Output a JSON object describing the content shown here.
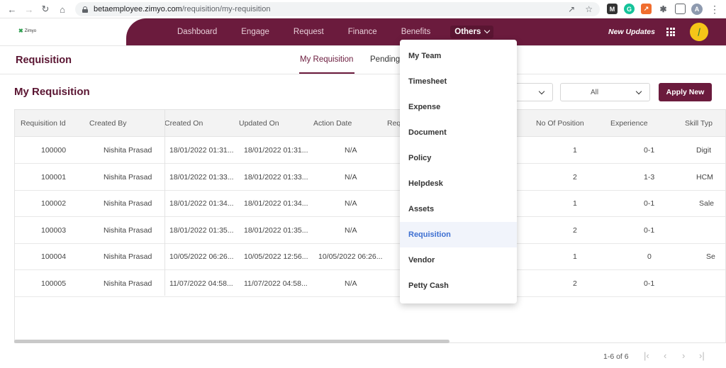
{
  "browser": {
    "url_host": "betaemployee.zimyo.com",
    "url_path": "/requisition/my-requisition",
    "profile_initial": "A"
  },
  "app": {
    "logo_text": "Zimyo",
    "nav": [
      "Dashboard",
      "Engage",
      "Request",
      "Finance",
      "Benefits"
    ],
    "nav_active": "Others",
    "new_updates": "New Updates",
    "brand_color": "#6b1b3d"
  },
  "subheader": {
    "title": "Requisition",
    "tab_active": "My Requisition",
    "tab_pending": "Pending"
  },
  "section": {
    "title": "My Requisition",
    "filter_value": "All",
    "apply_label": "Apply New"
  },
  "table": {
    "headers": [
      "Requisition Id",
      "Created By",
      "Created On",
      "Updated On",
      "Action Date",
      "Req",
      "No Of Position",
      "Experience",
      "Skill Typ"
    ],
    "rows": [
      {
        "id": "100000",
        "by": "Nishita Prasad",
        "created": "18/01/2022 01:31...",
        "updated": "18/01/2022 01:31...",
        "action": "N/A",
        "positions": "1",
        "experience": "0-1",
        "skill": "Digit"
      },
      {
        "id": "100001",
        "by": "Nishita Prasad",
        "created": "18/01/2022 01:33...",
        "updated": "18/01/2022 01:33...",
        "action": "N/A",
        "positions": "2",
        "experience": "1-3",
        "skill": "HCM"
      },
      {
        "id": "100002",
        "by": "Nishita Prasad",
        "created": "18/01/2022 01:34...",
        "updated": "18/01/2022 01:34...",
        "action": "N/A",
        "positions": "1",
        "experience": "0-1",
        "skill": "Sale"
      },
      {
        "id": "100003",
        "by": "Nishita Prasad",
        "created": "18/01/2022 01:35...",
        "updated": "18/01/2022 01:35...",
        "action": "N/A",
        "positions": "2",
        "experience": "0-1",
        "skill": ""
      },
      {
        "id": "100004",
        "by": "Nishita Prasad",
        "created": "10/05/2022 06:26...",
        "updated": "10/05/2022 12:56...",
        "action": "10/05/2022 06:26...",
        "positions": "1",
        "experience": "0",
        "skill": "Se"
      },
      {
        "id": "100005",
        "by": "Nishita Prasad",
        "created": "11/07/2022 04:58...",
        "updated": "11/07/2022 04:58...",
        "action": "N/A",
        "positions": "2",
        "experience": "0-1",
        "skill": ""
      }
    ]
  },
  "pagination": {
    "text": "1-6 of 6"
  },
  "dropdown": {
    "items": [
      "My Team",
      "Timesheet",
      "Expense",
      "Document",
      "Policy",
      "Helpdesk",
      "Assets",
      "Requisition",
      "Vendor",
      "Petty Cash"
    ],
    "selected": "Requisition"
  }
}
